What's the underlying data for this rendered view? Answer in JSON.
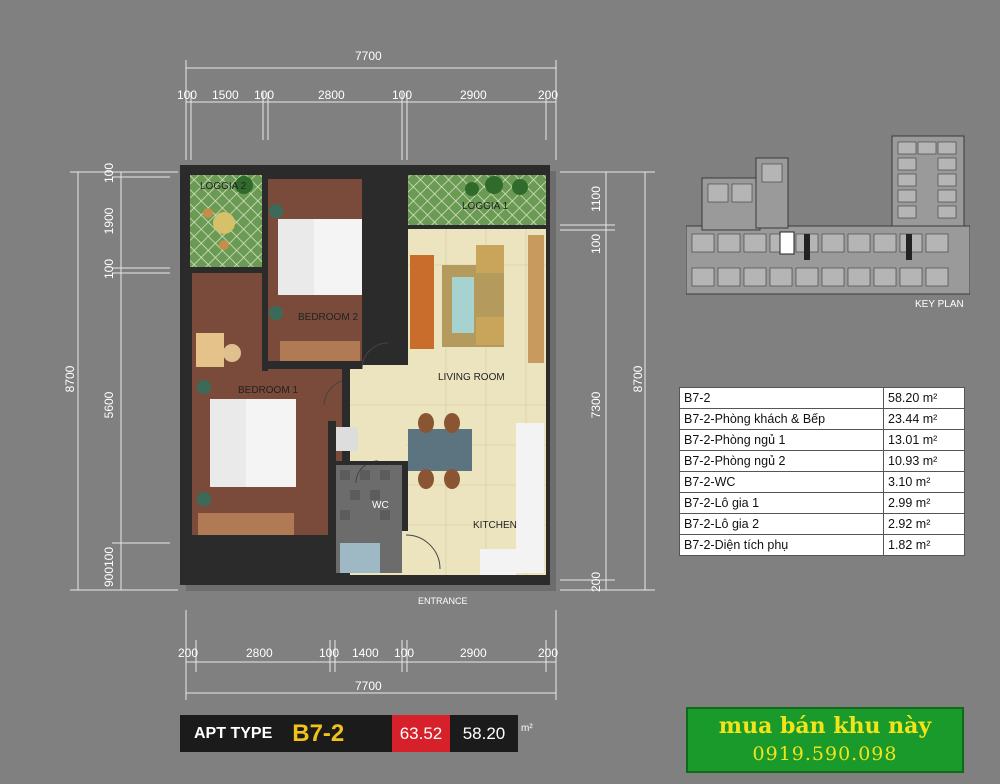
{
  "dimensions": {
    "top_total": "7700",
    "top_segments": [
      "100",
      "1500",
      "100",
      "2800",
      "100",
      "2900",
      "200"
    ],
    "bottom_segments": [
      "200",
      "2800",
      "100",
      "1400",
      "100",
      "2900",
      "200"
    ],
    "bottom_total": "7700",
    "left_total": "8700",
    "left_segments": [
      "100",
      "1900",
      "100",
      "5600",
      "900100"
    ],
    "right_total": "8700",
    "right_segments": [
      "1100",
      "100",
      "7300",
      "200"
    ]
  },
  "rooms": {
    "loggia2": "LOGGIA 2",
    "loggia1": "LOGGIA 1",
    "bedroom2": "BEDROOM 2",
    "bedroom1": "BEDROOM 1",
    "living": "LIVING ROOM",
    "wc": "WC",
    "kitchen": "KITCHEN",
    "entrance": "ENTRANCE"
  },
  "key_plan": {
    "label": "KEY PLAN"
  },
  "area_table": {
    "rows": [
      {
        "name": "B7-2",
        "value": "58.20 m²"
      },
      {
        "name": "B7-2-Phòng khách & Bếp",
        "value": "23.44 m²"
      },
      {
        "name": "B7-2-Phòng ngủ 1",
        "value": "13.01 m²"
      },
      {
        "name": "B7-2-Phòng ngủ 2",
        "value": "10.93 m²"
      },
      {
        "name": "B7-2-WC",
        "value": "3.10 m²"
      },
      {
        "name": "B7-2-Lô gia 1",
        "value": "2.99 m²"
      },
      {
        "name": "B7-2-Lô gia 2",
        "value": "2.92 m²"
      },
      {
        "name": "B7-2-Diện tích phụ",
        "value": "1.82 m²"
      }
    ]
  },
  "apt": {
    "label": "APT TYPE",
    "type": "B7-2",
    "gross": "63.52",
    "net": "58.20",
    "unit": "m²"
  },
  "promo": {
    "line1": "mua bán khu này",
    "line2": "0919.590.098"
  },
  "colors": {
    "background": "#808080",
    "wall": "#2b2b2b",
    "floor_wood": "#7a4a3a",
    "floor_tile": "#ece3bf",
    "loggia": "#5b8c4a",
    "red_box": "#d6202a",
    "promo_green": "#1a9a2a",
    "promo_text": "#f2e41a"
  }
}
